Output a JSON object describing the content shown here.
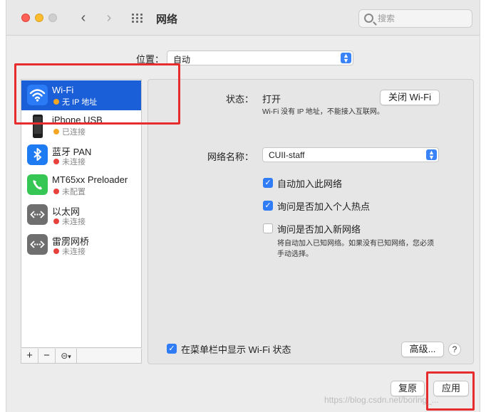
{
  "window": {
    "title": "网络"
  },
  "search": {
    "placeholder": "搜索"
  },
  "location": {
    "label": "位置：",
    "value": "自动"
  },
  "services": [
    {
      "name": "Wi-Fi",
      "status": "无 IP 地址",
      "status_color": "#f5a623",
      "icon": "wifi-icon"
    },
    {
      "name": "iPhone USB",
      "status": "已连接",
      "status_color": "#f5a623",
      "icon": "iphone-icon"
    },
    {
      "name": "蓝牙 PAN",
      "status": "未连接",
      "status_color": "#e8413c",
      "icon": "bluetooth-icon"
    },
    {
      "name": "MT65xx Preloader",
      "status": "未配置",
      "status_color": "#e8413c",
      "icon": "phone-icon"
    },
    {
      "name": "以太网",
      "status": "未连接",
      "status_color": "#e8413c",
      "icon": "ethernet-icon"
    },
    {
      "name": "雷雳网桥",
      "status": "未连接",
      "status_color": "#e8413c",
      "icon": "thunderbolt-bridge-icon"
    }
  ],
  "sidebar_footer": {
    "add": "+",
    "remove": "−",
    "action": "⊝"
  },
  "detail": {
    "status_label": "状态：",
    "status_value": "打开",
    "turn_off_button": "关闭 Wi-Fi",
    "status_note": "Wi-Fi 没有 IP 地址，不能接入互联网。",
    "network_name_label": "网络名称：",
    "network_name": "CUII-staff",
    "options": [
      {
        "label": "自动加入此网络",
        "checked": true
      },
      {
        "label": "询问是否加入个人热点",
        "checked": true
      },
      {
        "label": "询问是否加入新网络",
        "checked": false
      }
    ],
    "join_note_line1": "将自动加入已知网络。如果没有已知网络，您必须",
    "join_note_line2": "手动选择。",
    "show_in_menubar": {
      "label": "在菜单栏中显示 Wi-Fi 状态",
      "checked": true
    },
    "advanced_button": "高级...",
    "help": "?"
  },
  "bottom": {
    "revert": "复原",
    "apply": "应用"
  },
  "watermark": "https://blog.csdn.net/boring_..."
}
